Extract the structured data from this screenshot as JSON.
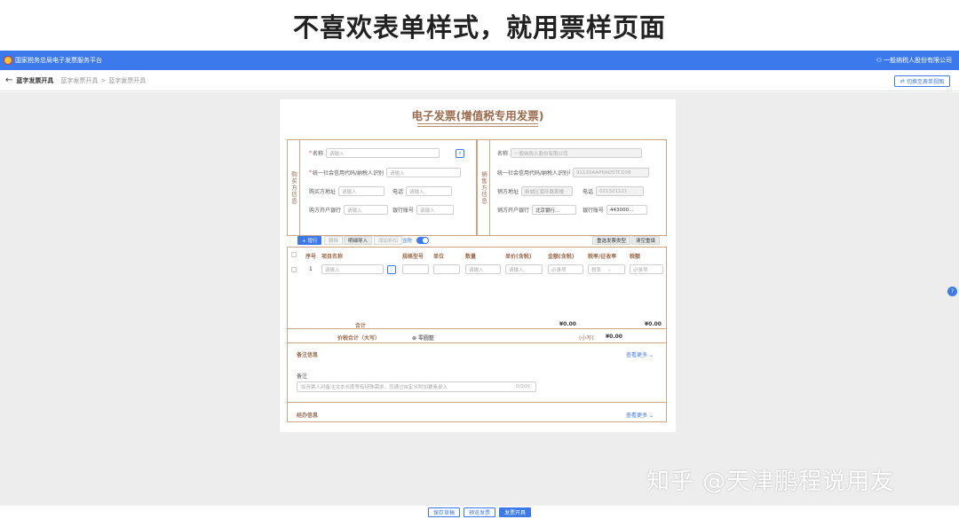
{
  "slide": {
    "title": "不喜欢表单样式，就用票样页面"
  },
  "header": {
    "platform": "国家税务总局电子发票服务平台",
    "user": "一般纳税人股份有限公司"
  },
  "breadcrumb": {
    "current": "蓝字发票开具",
    "trail": [
      "蓝字发票开具",
      "蓝字发票开具"
    ],
    "switch_label": "切换至表单视图"
  },
  "invoice": {
    "title": "电子发票(增值税专用发票)",
    "buyer": {
      "side_label": "购买方信息",
      "name_label": "名称",
      "name_placeholder": "请输入",
      "taxid_label": "统一社会信用代码/纳税人识别号",
      "taxid_placeholder": "请输入",
      "address_label": "购买方地址",
      "address_placeholder": "请输入",
      "phone_label": "电话",
      "phone_placeholder": "请输入",
      "bank_label": "购方开户银行",
      "bank_placeholder": "请输入",
      "account_label": "银行账号",
      "account_placeholder": "请输入"
    },
    "seller": {
      "side_label": "销售方信息",
      "name_label": "名称",
      "name_value": "一般纳税人股份有限公司",
      "taxid_label": "统一社会信用代码/纳税人识别号",
      "taxid_value": "91120AAP6AD5TCD38",
      "address_label": "销方地址",
      "address_value": "新城区南环路首楼",
      "phone_label": "电话",
      "phone_value": "021321121",
      "bank_label": "销方开户银行",
      "bank_value": "北京银行...",
      "account_label": "银行账号",
      "account_value": "443000..."
    },
    "toolbar": {
      "add_row": "+ 增行",
      "delete": "删除",
      "batch_import": "明细导入",
      "add_discount": "添加折扣",
      "tax_inclusive": "含税",
      "select_type": "重选发票类型",
      "clear": "清空重填"
    },
    "columns": [
      "序号",
      "项目名称",
      "规格型号",
      "单位",
      "数量",
      "单价(含税)",
      "金额(含税)",
      "税率/征收率",
      "税额"
    ],
    "rows": [
      {
        "no": "1",
        "name_placeholder": "请输入",
        "qty_placeholder": "请输入",
        "price_placeholder": "请输入",
        "amount_placeholder": "必录项",
        "rate_placeholder": "税率",
        "tax_placeholder": "必录项"
      }
    ],
    "total": {
      "label": "合计",
      "amount": "¥0.00",
      "tax": "¥0.00"
    },
    "price_tax": {
      "label": "价税合计（大写）",
      "words": "⊗ 零圆整",
      "small_label": "(小写)",
      "small_value": "¥0.00"
    },
    "remark": {
      "section": "备注信息",
      "more": "查看更多 ⌄",
      "field_label": "备注",
      "placeholder": "如开票人对备注文本长度等有特殊需求，您通过自定义附加要素录入",
      "counter": "0/200"
    },
    "agent": {
      "section": "经办信息",
      "more": "查看更多 ⌄"
    }
  },
  "footer": {
    "save_draft": "保存草稿",
    "preview": "预览发票",
    "issue": "发票开具"
  },
  "watermark": "知乎 @天津鹏程说用友"
}
